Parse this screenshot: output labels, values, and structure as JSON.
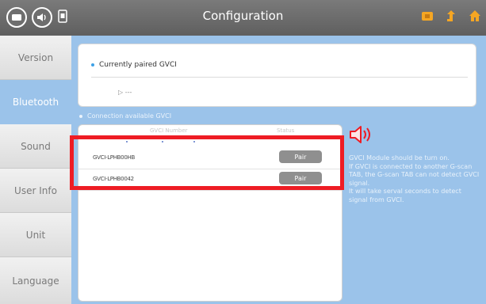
{
  "header": {
    "title": "Configuration",
    "left_icons": [
      "menu-icon",
      "speaker-icon",
      "clipboard-icon"
    ],
    "right_icons": [
      "capture-icon",
      "upload-arrow-icon",
      "home-icon"
    ],
    "accent_color": "#f5a623"
  },
  "sidebar": {
    "items": [
      {
        "label": "Version",
        "active": false
      },
      {
        "label": "Bluetooth",
        "active": true
      },
      {
        "label": "Sound",
        "active": false
      },
      {
        "label": "User Info",
        "active": false
      },
      {
        "label": "Unit",
        "active": false
      },
      {
        "label": "Language",
        "active": false
      }
    ]
  },
  "paired": {
    "label": "Currently paired GVCI",
    "value": "▷ ---"
  },
  "available": {
    "label": "Connection available GVCI",
    "columns": [
      "GVCI Number",
      "Status"
    ],
    "rows": [
      {
        "name": "GVCI-LPHB00HB",
        "button": "Pair"
      },
      {
        "name": "GVCI-LPHB0042",
        "button": "Pair"
      }
    ]
  },
  "info": {
    "lines": [
      "GVCI Module should be turn on.",
      "If GVCI is connected to another G-scan TAB, the G-scan TAB can not detect GVCI signal.",
      "It will take serval seconds to detect signal from GVCI."
    ]
  },
  "colors": {
    "main_bg": "#9bc3ea",
    "highlight": "#ee1c24",
    "header_bg": "#6a6a6a"
  }
}
